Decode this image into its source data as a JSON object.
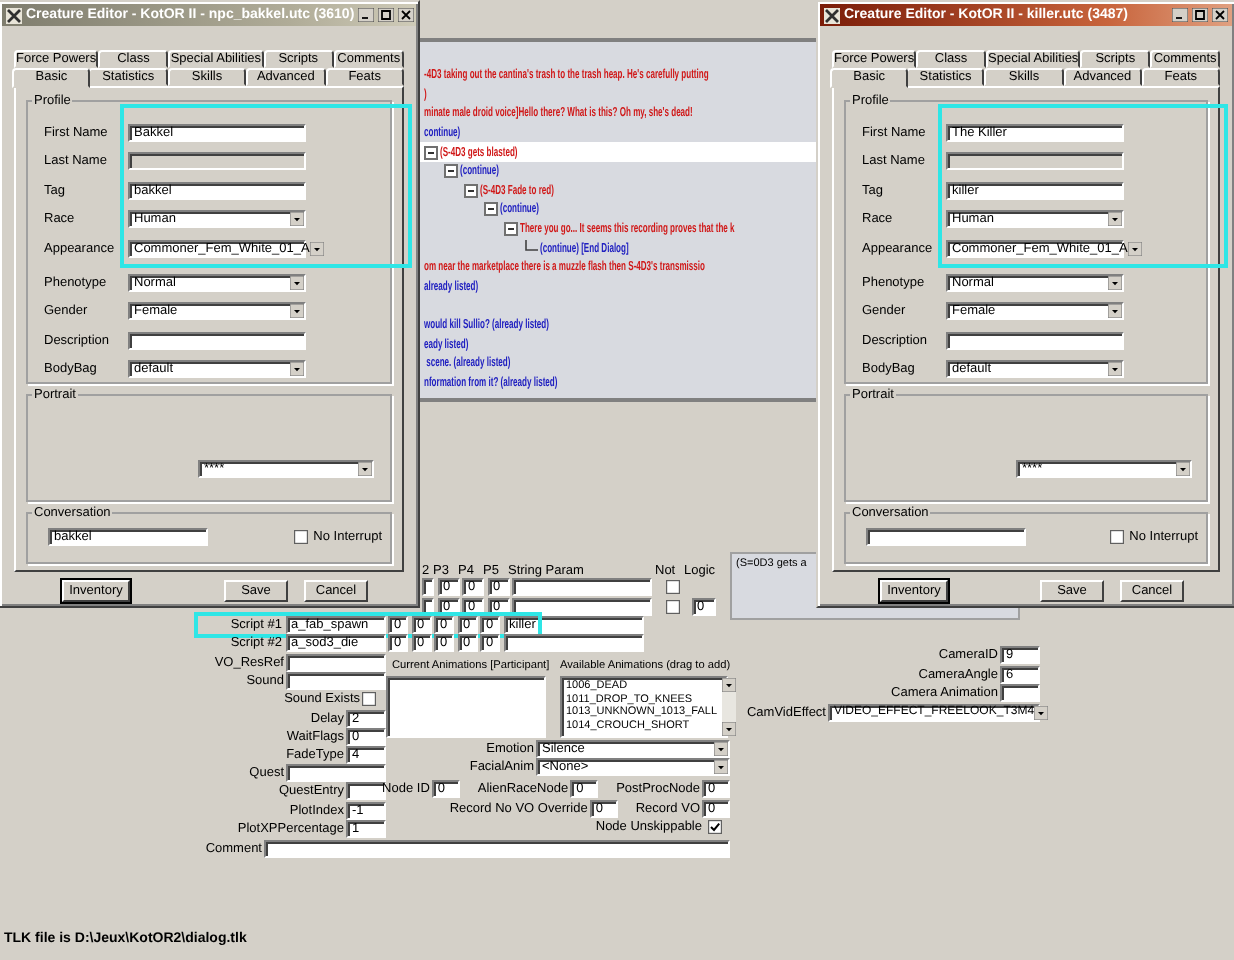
{
  "dialog_editor": {
    "tree": [
      {
        "text": "-4D3 taking out the cantina's trash to the trash heap. He's carefully putting",
        "kind": "entry",
        "selected": false
      },
      {
        "text": ")",
        "kind": "entry",
        "selected": false
      },
      {
        "text": "minate male droid voice]Hello there? What is this? Oh my, she's dead!",
        "kind": "entry",
        "selected": false
      },
      {
        "text": "continue)",
        "kind": "reply",
        "selected": false
      },
      {
        "text": "(S-4D3 gets blasted)",
        "kind": "entry",
        "selected": true,
        "expanded": true,
        "children": [
          {
            "text": "(continue)",
            "kind": "reply",
            "selected": false,
            "expanded": true,
            "children": [
              {
                "text": "(S-4D3 Fade to red)",
                "kind": "entry",
                "selected": false,
                "expanded": true,
                "children": [
                  {
                    "text": "(continue)",
                    "kind": "reply",
                    "selected": false,
                    "expanded": true,
                    "children": [
                      {
                        "text": "There you go... It seems this recording proves that the k",
                        "kind": "entry",
                        "selected": false,
                        "expanded": true,
                        "children": [
                          {
                            "text": "(continue) [End Dialog]",
                            "kind": "reply",
                            "selected": false
                          }
                        ]
                      }
                    ]
                  }
                ]
              }
            ]
          }
        ]
      },
      {
        "text": "om near the marketplace there is a muzzle flash then S-4D3's transmissio",
        "kind": "entry",
        "selected": false
      },
      {
        "text": "already listed)",
        "kind": "reply",
        "selected": false
      },
      {
        "kind": "blank",
        "selected": false
      },
      {
        "text": "would kill Sullio? (already listed)",
        "kind": "reply",
        "selected": false
      },
      {
        "text": "eady listed)",
        "kind": "reply",
        "selected": false
      },
      {
        "text": " scene. (already listed)",
        "kind": "reply",
        "selected": false
      },
      {
        "text": "nformation from it? (already listed)",
        "kind": "reply",
        "selected": false
      }
    ],
    "params": {
      "header": [
        "2",
        "P3",
        "P4",
        "P5",
        "String Param",
        "Not",
        "Logic"
      ],
      "rows": [
        {
          "values": [
            "0",
            "0",
            "0"
          ],
          "not_checked": false
        },
        {
          "values": [
            "0",
            "0",
            "0"
          ],
          "not_checked": false,
          "logic": "0"
        }
      ]
    },
    "scripts": [
      {
        "label": "Script #1",
        "resref": "a_fab_spawn",
        "params": [
          "0",
          "0",
          "0",
          "0",
          "0"
        ],
        "string_param": "killer",
        "highlighted": true
      },
      {
        "label": "Script #2",
        "resref": "a_sod3_die",
        "params": [
          "0",
          "0",
          "0",
          "0",
          "0"
        ],
        "highlighted": false
      }
    ],
    "preview_text": "(S=0D3 gets a",
    "fields": [
      {
        "label": "VO_ResRef",
        "kind": "wide"
      },
      {
        "label": "Sound",
        "kind": "wide"
      },
      {
        "label": "Sound Exists",
        "kind": "checkbox",
        "checked": false
      },
      {
        "label": "Delay",
        "kind": "narrow",
        "value": "2"
      },
      {
        "label": "WaitFlags",
        "kind": "narrow",
        "value": "0"
      },
      {
        "label": "FadeType",
        "kind": "narrow",
        "value": "4"
      },
      {
        "label": "Quest",
        "kind": "wide"
      },
      {
        "label": "QuestEntry",
        "kind": "narrow"
      },
      {
        "label": "PlotIndex",
        "kind": "narrow",
        "value": "-1"
      },
      {
        "label": "PlotXPPercentage",
        "kind": "narrow",
        "value": "1"
      }
    ],
    "animations": {
      "current_label": "Current Animations [Participant]",
      "available_label": "Available Animations (drag to add)",
      "available": [
        "1006_DEAD",
        "1011_DROP_TO_KNEES",
        "1013_UNKNOWN_1013_FALL",
        "1014_CROUCH_SHORT"
      ]
    },
    "emotion_fields": [
      {
        "label": "Emotion",
        "value": "Silence"
      },
      {
        "label": "FacialAnim",
        "value": "<None>"
      }
    ],
    "node_rows": [
      [
        {
          "label": "Node ID",
          "value": "0"
        },
        {
          "label": "AlienRaceNode",
          "value": "0"
        },
        {
          "label": "PostProcNode",
          "value": "0"
        }
      ],
      [
        {
          "label": "Record No VO Override",
          "value": "0"
        },
        {
          "label": "Record VO",
          "value": "0"
        }
      ]
    ],
    "node_unskippable": {
      "label": "Node Unskippable",
      "checked": true
    },
    "camera_fields": [
      {
        "label": "CameraID",
        "kind": "text",
        "value": "9"
      },
      {
        "label": "CameraAngle",
        "kind": "text",
        "value": "6"
      },
      {
        "label": "Camera Animation",
        "kind": "text"
      },
      {
        "label": "CamVidEffect",
        "kind": "dropdown",
        "value": "VIDEO_EFFECT_FREELOOK_T3M4"
      }
    ],
    "comment": {
      "label": "Comment"
    },
    "status": "TLK file is D:\\Jeux\\KotOR2\\dialog.tlk"
  },
  "creature_editors": [
    {
      "title": "Creature Editor - KotOR II - npc_bakkel.utc (3610)",
      "active": false,
      "tabs_back": [
        "Force Powers",
        "Class",
        "Special Abilities",
        "Scripts",
        "Comments"
      ],
      "tabs": [
        {
          "label": "Basic",
          "selected": true
        },
        {
          "label": "Statistics",
          "selected": false
        },
        {
          "label": "Skills",
          "selected": false
        },
        {
          "label": "Advanced",
          "selected": false
        },
        {
          "label": "Feats",
          "selected": false
        }
      ],
      "profile_title": "Profile",
      "fields": [
        {
          "label": "First Name",
          "kind": "text",
          "value": "Bakkel",
          "highlighted": true
        },
        {
          "label": "Last Name",
          "kind": "readonly",
          "highlighted": true
        },
        {
          "label": "Tag",
          "kind": "text",
          "value": "bakkel",
          "highlighted": true
        },
        {
          "label": "Race",
          "kind": "dropdown",
          "value": "Human",
          "highlighted": true
        },
        {
          "label": "Appearance",
          "kind": "dropdown",
          "value": "Commoner_Fem_White_01_A",
          "highlighted": true
        },
        {
          "label": "Phenotype",
          "kind": "dropdown",
          "value": "Normal",
          "highlighted": false
        },
        {
          "label": "Gender",
          "kind": "dropdown",
          "value": "Female",
          "highlighted": false
        },
        {
          "label": "Description",
          "kind": "text",
          "highlighted": false
        },
        {
          "label": "BodyBag",
          "kind": "dropdown",
          "value": "default",
          "highlighted": false
        }
      ],
      "portrait": {
        "title": "Portrait",
        "value": "****"
      },
      "conversation": {
        "title": "Conversation",
        "value": "bakkel",
        "no_interrupt": {
          "label": "No Interrupt",
          "checked": false
        }
      },
      "buttons": [
        "Inventory",
        "Save",
        "Cancel"
      ]
    },
    {
      "title": "Creature Editor - KotOR II - killer.utc (3487)",
      "active": true,
      "tabs_back": [
        "Force Powers",
        "Class",
        "Special Abilities",
        "Scripts",
        "Comments"
      ],
      "tabs": [
        {
          "label": "Basic",
          "selected": true
        },
        {
          "label": "Statistics",
          "selected": false
        },
        {
          "label": "Skills",
          "selected": false
        },
        {
          "label": "Advanced",
          "selected": false
        },
        {
          "label": "Feats",
          "selected": false
        }
      ],
      "profile_title": "Profile",
      "fields": [
        {
          "label": "First Name",
          "kind": "text",
          "value": "The Killer",
          "highlighted": true
        },
        {
          "label": "Last Name",
          "kind": "readonly",
          "highlighted": true
        },
        {
          "label": "Tag",
          "kind": "text",
          "value": "killer",
          "highlighted": true
        },
        {
          "label": "Race",
          "kind": "dropdown",
          "value": "Human",
          "highlighted": true
        },
        {
          "label": "Appearance",
          "kind": "dropdown",
          "value": "Commoner_Fem_White_01_A",
          "highlighted": true
        },
        {
          "label": "Phenotype",
          "kind": "dropdown",
          "value": "Normal",
          "highlighted": false
        },
        {
          "label": "Gender",
          "kind": "dropdown",
          "value": "Female",
          "highlighted": false
        },
        {
          "label": "Description",
          "kind": "text",
          "highlighted": false
        },
        {
          "label": "BodyBag",
          "kind": "dropdown",
          "value": "default",
          "highlighted": false
        }
      ],
      "portrait": {
        "title": "Portrait",
        "value": "****"
      },
      "conversation": {
        "title": "Conversation",
        "no_interrupt": {
          "label": "No Interrupt",
          "checked": false
        }
      },
      "buttons": [
        "Inventory",
        "Save",
        "Cancel"
      ]
    }
  ]
}
